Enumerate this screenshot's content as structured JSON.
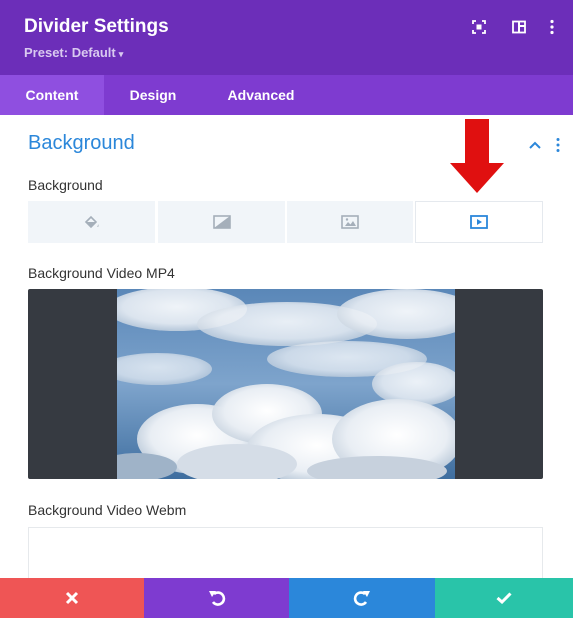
{
  "header": {
    "title": "Divider Settings",
    "preset": "Preset: Default",
    "icons": [
      "focus-icon",
      "split-view-icon",
      "more-vertical-icon"
    ]
  },
  "tabs": [
    {
      "label": "Content",
      "active": true
    },
    {
      "label": "Design",
      "active": false
    },
    {
      "label": "Advanced",
      "active": false
    }
  ],
  "section": {
    "title": "Background",
    "icons": [
      "chevron-up-icon",
      "more-vertical-icon"
    ]
  },
  "background": {
    "label": "Background",
    "types": [
      {
        "icon": "paint-bucket-icon",
        "active": false
      },
      {
        "icon": "gradient-icon",
        "active": false
      },
      {
        "icon": "image-icon",
        "active": false
      },
      {
        "icon": "video-icon",
        "active": true
      }
    ]
  },
  "video_mp4": {
    "label": "Background Video MP4"
  },
  "video_webm": {
    "label": "Background Video Webm"
  },
  "footer": [
    {
      "icon": "close-icon",
      "color": "#ef5555"
    },
    {
      "icon": "undo-icon",
      "color": "#7e3bd0"
    },
    {
      "icon": "redo-icon",
      "color": "#2b87da"
    },
    {
      "icon": "check-icon",
      "color": "#29c4a9"
    }
  ],
  "colors": {
    "header": "#6c2eb9",
    "tabs": "#7e3bd0",
    "accent": "#2b87da",
    "arrow": "#e01010"
  }
}
